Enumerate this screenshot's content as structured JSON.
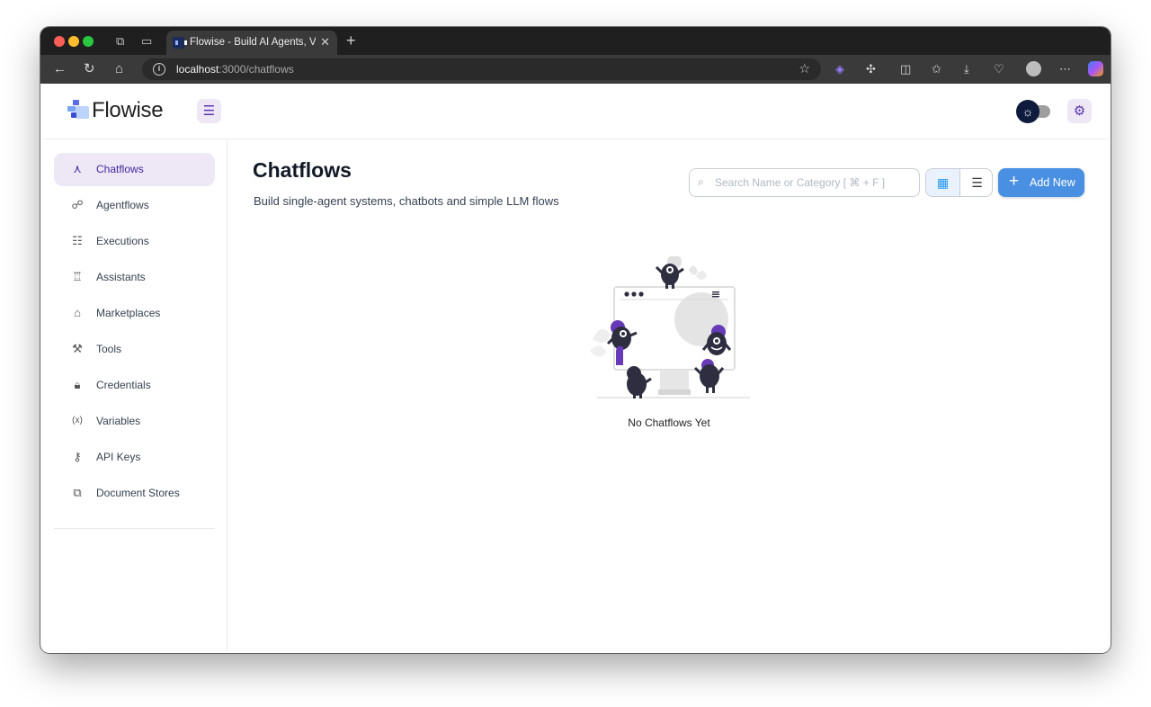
{
  "browser": {
    "tab_title": "Flowise - Build AI Agents, Visually",
    "url_host": "localhost",
    "url_path": ":3000/chatflows"
  },
  "app": {
    "logo_text": "Flowise"
  },
  "sidebar": {
    "items": [
      {
        "label": "Chatflows",
        "icon": "chatflows-icon",
        "active": true
      },
      {
        "label": "Agentflows",
        "icon": "agentflows-icon"
      },
      {
        "label": "Executions",
        "icon": "executions-icon"
      },
      {
        "label": "Assistants",
        "icon": "assistants-icon"
      },
      {
        "label": "Marketplaces",
        "icon": "marketplaces-icon"
      },
      {
        "label": "Tools",
        "icon": "tools-icon"
      },
      {
        "label": "Credentials",
        "icon": "lock-icon"
      },
      {
        "label": "Variables",
        "icon": "variables-icon"
      },
      {
        "label": "API Keys",
        "icon": "key-icon"
      },
      {
        "label": "Document Stores",
        "icon": "documents-icon"
      }
    ]
  },
  "main": {
    "title": "Chatflows",
    "subtitle": "Build single-agent systems, chatbots and simple LLM flows",
    "search_placeholder": "Search Name or Category [ ⌘ + F ]",
    "add_new_label": "Add New",
    "view_mode": "grid",
    "empty_text": "No Chatflows Yet"
  },
  "colors": {
    "accent": "#4a90e2",
    "active_nav_bg": "#ede7f6",
    "active_nav_text": "#4527a0",
    "illustration_purple": "#673ab7"
  }
}
